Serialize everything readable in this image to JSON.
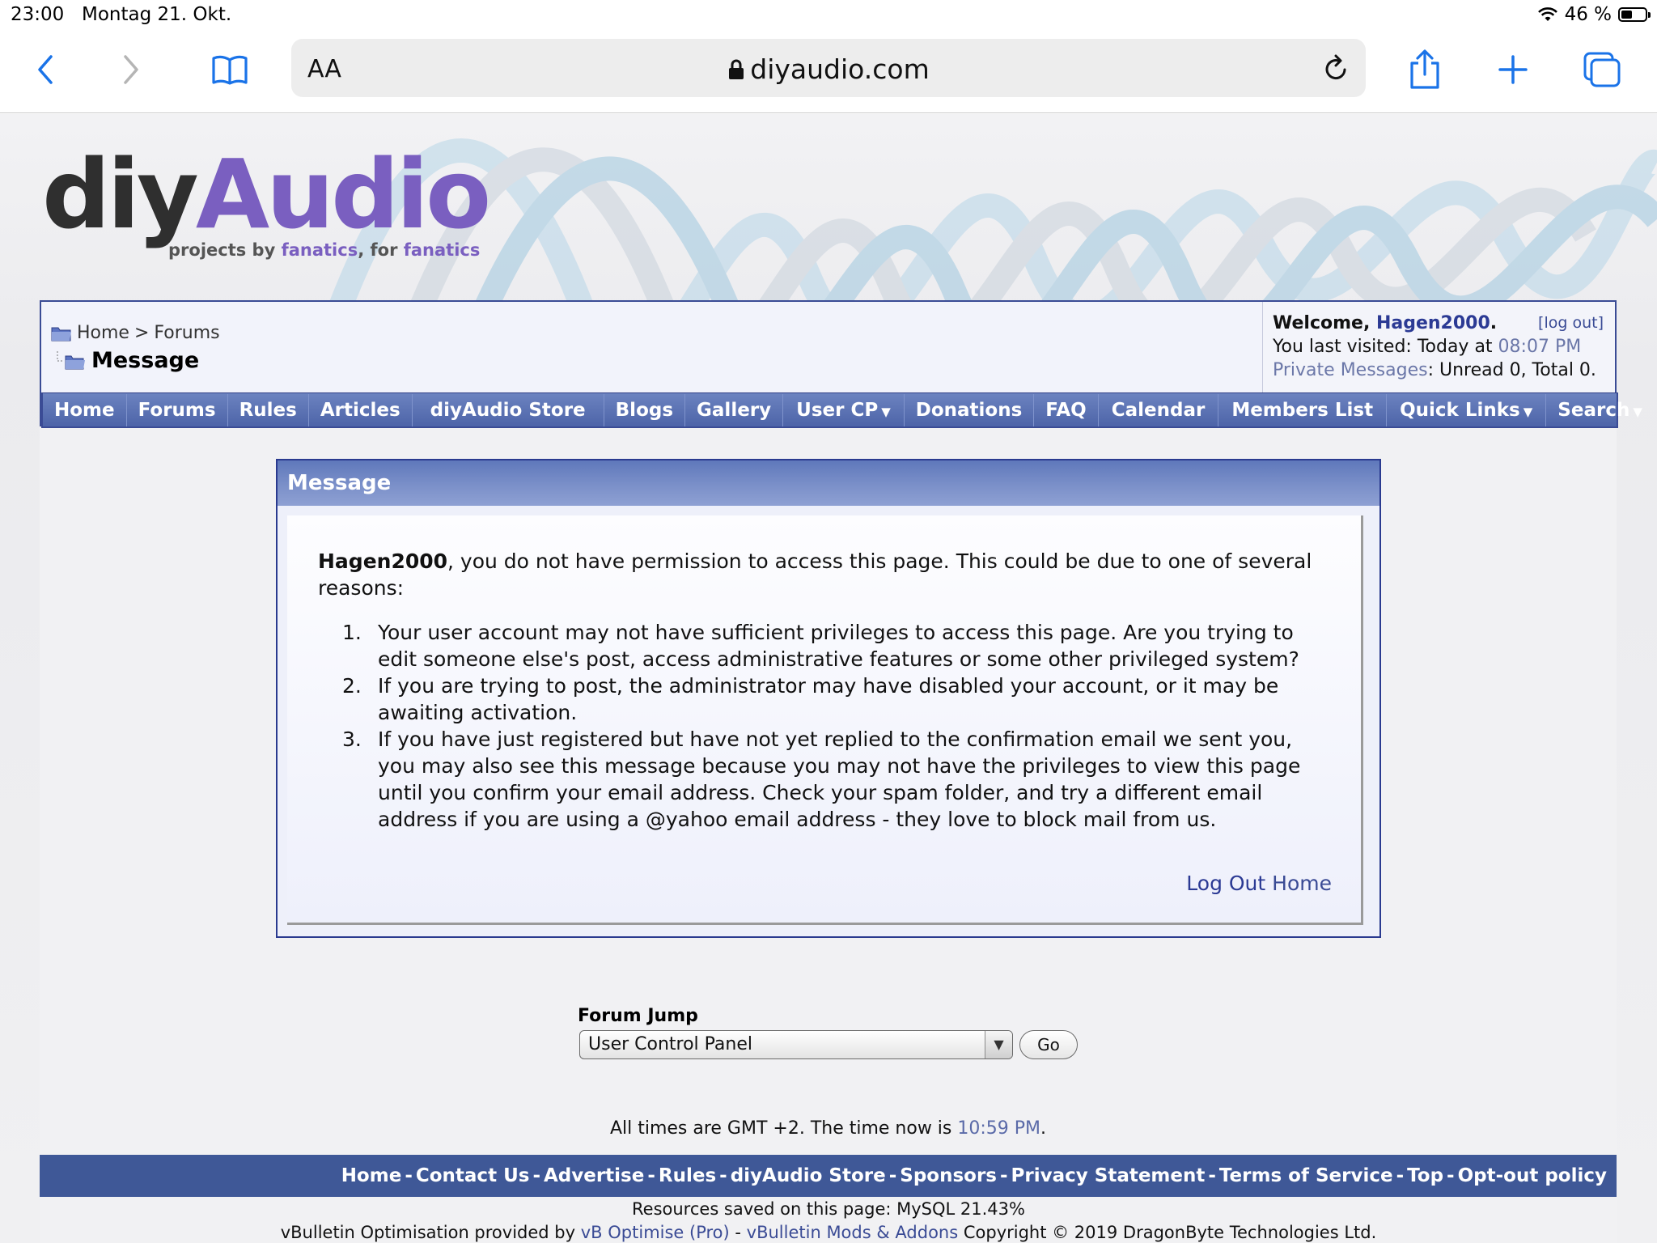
{
  "statusbar": {
    "time": "23:00",
    "date": "Montag 21. Okt.",
    "battery": "46 %",
    "battery_level": 0.46
  },
  "browser": {
    "text_size_label": "AA",
    "url": "diyaudio.com",
    "icons": [
      "back-icon",
      "forward-icon",
      "bookmarks-icon",
      "lock-icon",
      "reload-icon",
      "share-icon",
      "new-tab-icon",
      "tabs-icon"
    ]
  },
  "logo": {
    "diy": "diy",
    "audio": "Audio",
    "tag_1": "projects by ",
    "tag_2": "fanatics",
    "tag_3": ", for ",
    "tag_4": "fanatics"
  },
  "breadcrumb": {
    "home": "Home",
    "sep": ">",
    "forums": "Forums",
    "current": "Message"
  },
  "welcome": {
    "prefix": "Welcome, ",
    "user": "Hagen2000",
    "dot": ".",
    "logout": "[log out]",
    "last_visited_prefix": "You last visited: Today at ",
    "last_visited_time": "08:07 PM",
    "pm_label": "Private Messages",
    "pm_text": ": Unread 0, Total 0."
  },
  "navbar": {
    "items": [
      {
        "label": "Home"
      },
      {
        "label": "Forums"
      },
      {
        "label": "Rules"
      },
      {
        "label": "Articles"
      },
      {
        "label": "diyAudio Store"
      },
      {
        "label": "Blogs"
      },
      {
        "label": "Gallery"
      },
      {
        "label": "User CP"
      },
      {
        "label": "Donations"
      },
      {
        "label": "FAQ"
      },
      {
        "label": "Calendar"
      },
      {
        "label": "Members List"
      },
      {
        "label": "Quick Links"
      },
      {
        "label": "Search"
      }
    ]
  },
  "message": {
    "title": "Message",
    "user": "Hagen2000",
    "intro": ", you do not have permission to access this page. This could be due to one of several reasons:",
    "reasons": [
      {
        "num": "1.",
        "text": "Your user account may not have sufficient privileges to access this page. Are you trying to edit someone else's post, access administrative features or some other privileged system?"
      },
      {
        "num": "2.",
        "text": "If you are trying to post, the administrator may have disabled your account, or it may be awaiting activation."
      },
      {
        "num": "3.",
        "text": "If you have just registered but have not yet replied to the confirmation email we sent you, you may also see this message because you may not have the privileges to view this page until you confirm your email address. Check your spam folder, and try a different email address if you are using a @yahoo email address - they love to block mail from us."
      }
    ],
    "logout_link": "Log Out",
    "home_link": "Home"
  },
  "forum_jump": {
    "label": "Forum Jump",
    "selected": "User Control Panel",
    "go": "Go"
  },
  "timeinfo": {
    "prefix": "All times are GMT +2. The time now is ",
    "time": "10:59 PM",
    "suffix": "."
  },
  "footer": {
    "links": [
      "Home",
      "Contact Us",
      "Advertise",
      "Rules",
      "diyAudio Store",
      "Sponsors",
      "Privacy Statement",
      "Terms of Service",
      "Top",
      "Opt-out policy"
    ],
    "separator": "-"
  },
  "credits": {
    "resources": "Resources saved on this page: MySQL 21.43%",
    "prefix": "vBulletin Optimisation provided by ",
    "link1": "vB Optimise (Pro)",
    "dash": " - ",
    "link2": "vBulletin Mods & Addons",
    "suffix": " Copyright © 2019 DragonByte Technologies Ltd."
  },
  "colors": {
    "nav_blue": "#4d64a8",
    "border_blue": "#2a3a8f",
    "logo_purple": "#7a5fc0",
    "footer_blue": "#3f5897"
  }
}
